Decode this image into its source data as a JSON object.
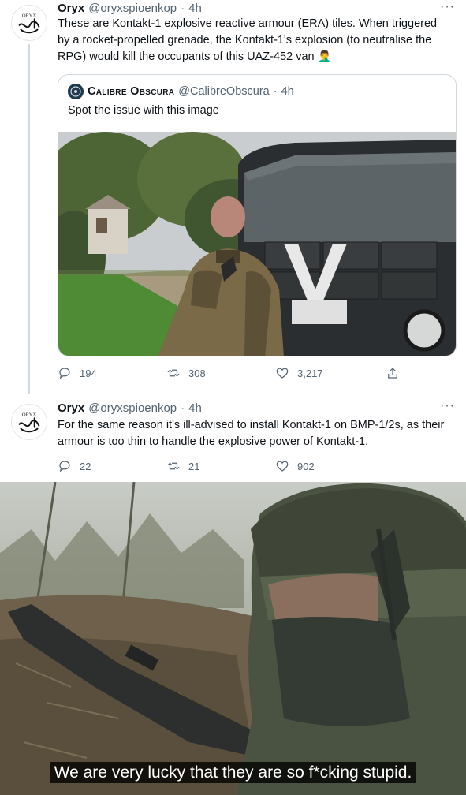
{
  "tweet1": {
    "avatar_text": "ORYX",
    "name": "Oryx",
    "handle": "@oryxspioenkop",
    "dot": "·",
    "time": "4h",
    "more_label": "···",
    "text": "These are Kontakt-1 explosive reactive armour (ERA) tiles. When triggered by a rocket-propelled grenade, the Kontakt-1's explosion (to neutralise the RPG) would kill the occupants of this UAZ-452 van 🤦‍♂️",
    "quote": {
      "name": "Calibre Obscura",
      "handle": "@CalibreObscura",
      "dot": "·",
      "time": "4h",
      "text": "Spot the issue with this image"
    },
    "actions": {
      "replies": "194",
      "retweets": "308",
      "likes": "3,217"
    }
  },
  "tweet2": {
    "avatar_text": "ORYX",
    "name": "Oryx",
    "handle": "@oryxspioenkop",
    "dot": "·",
    "time": "4h",
    "more_label": "···",
    "text": "For the same reason it's ill-advised to install Kontakt-1 on BMP-1/2s, as their armour is too thin to handle the explosive power of Kontakt-1.",
    "actions": {
      "replies": "22",
      "retweets": "21",
      "likes": "902"
    }
  },
  "meme": {
    "caption": "We are very lucky that they are so f*cking stupid."
  },
  "icons": {
    "reply": "reply-icon",
    "retweet": "retweet-icon",
    "like": "heart-icon",
    "share": "share-icon"
  },
  "colors": {
    "text": "#0f1419",
    "secondary": "#536471",
    "border": "#cfd9de"
  }
}
